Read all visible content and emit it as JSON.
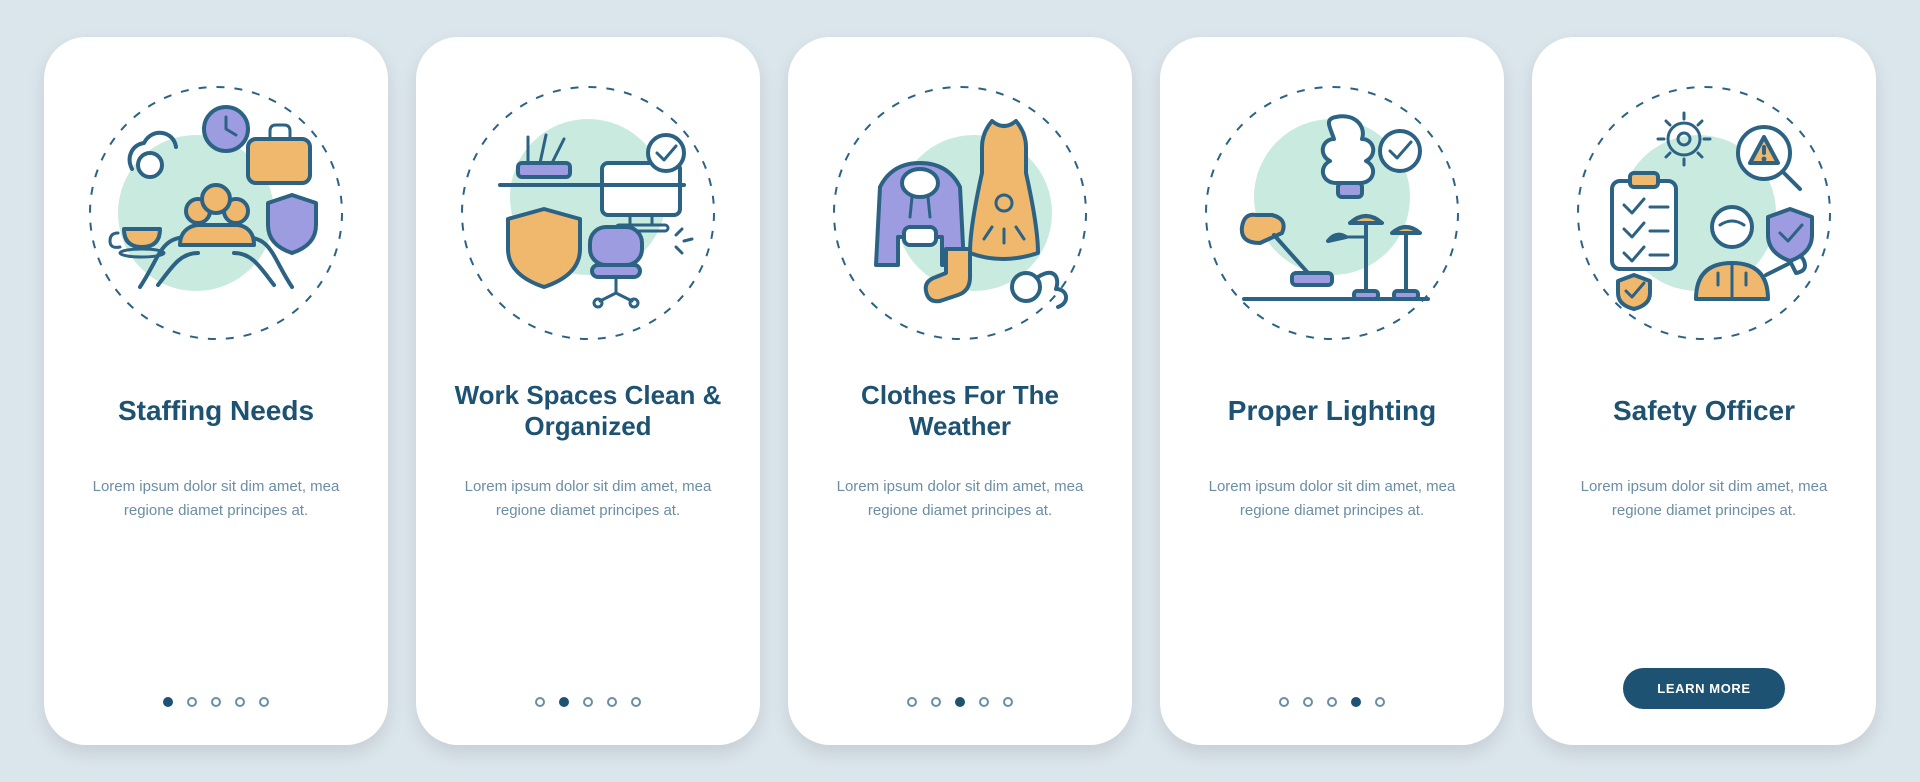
{
  "colors": {
    "page_bg": "#dbe5ec",
    "card_bg": "#ffffff",
    "ink": "#1e5273",
    "muted": "#6b8ea3",
    "teal": "#c8eadf",
    "orange": "#f0b86c",
    "purple": "#9d9ce0",
    "navy": "#2c6384"
  },
  "cta_label": "LEARN MORE",
  "total_slides": 5,
  "shared_description": "Lorem ipsum dolor sit dim amet, mea regione diamet principes at.",
  "slides": [
    {
      "title": "Staffing Needs",
      "description": "Lorem ipsum dolor sit dim amet, mea regione diamet principes at.",
      "active_index": 0,
      "icon": "staffing-icon",
      "has_cta": false
    },
    {
      "title": "Work Spaces Clean & Organized",
      "description": "Lorem ipsum dolor sit dim amet, mea regione diamet principes at.",
      "active_index": 1,
      "icon": "workspace-icon",
      "has_cta": false
    },
    {
      "title": "Clothes For The Weather",
      "description": "Lorem ipsum dolor sit dim amet, mea regione diamet principes at.",
      "active_index": 2,
      "icon": "clothes-icon",
      "has_cta": false
    },
    {
      "title": "Proper Lighting",
      "description": "Lorem ipsum dolor sit dim amet, mea regione diamet principes at.",
      "active_index": 3,
      "icon": "lighting-icon",
      "has_cta": false
    },
    {
      "title": "Safety Officer",
      "description": "Lorem ipsum dolor sit dim amet, mea regione diamet principes at.",
      "active_index": 4,
      "icon": "safety-officer-icon",
      "has_cta": true
    }
  ]
}
